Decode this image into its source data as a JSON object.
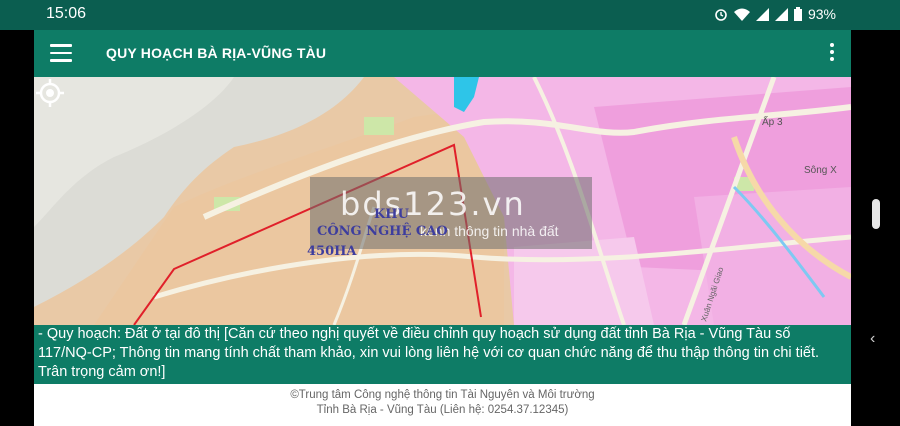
{
  "status_bar": {
    "time": "15:06",
    "battery": "93%",
    "icons": [
      "alarm-icon",
      "wifi-icon",
      "signal-icon",
      "signal-icon",
      "battery-icon"
    ]
  },
  "app_bar": {
    "title": "QUY HOẠCH BÀ RỊA-VŨNG TÀU"
  },
  "map": {
    "watermark": {
      "main": "bds123.vn",
      "sub": "kênh thông tin nhà đất"
    },
    "zone_label": {
      "line1": "KHU",
      "line2": "CÔNG NGHỆ CAO",
      "line3": "450HA"
    },
    "place_labels": [
      "Ấp 3",
      "Sông X",
      "Xuân Ngãi Giao"
    ]
  },
  "info_panel": {
    "text": "- Quy hoạch: Đất ở tại đô thị  [Căn cứ theo nghị quyết về điều chỉnh quy hoạch sử dụng đất tỉnh Bà Rịa - Vũng Tàu số 117/NQ-CP; Thông tin mang tính chất tham khảo, xin vui lòng liên hệ với cơ quan chức năng để thu thập thông tin chi tiết. Trân trọng cảm ơn!]"
  },
  "footer": {
    "line1": "©Trung tâm Công nghệ thông tin Tài Nguyên và Môi trường",
    "line2": "Tỉnh Bà Rịa - Vũng Tàu (Liên hệ: 0254.37.12345)"
  },
  "colors": {
    "status_bar": "#0b5e50",
    "app_bar": "#0e7c66",
    "map_residential": "#e9c9a6",
    "map_industrial": "#f2b8e6",
    "boundary_line": "#e0202a"
  }
}
